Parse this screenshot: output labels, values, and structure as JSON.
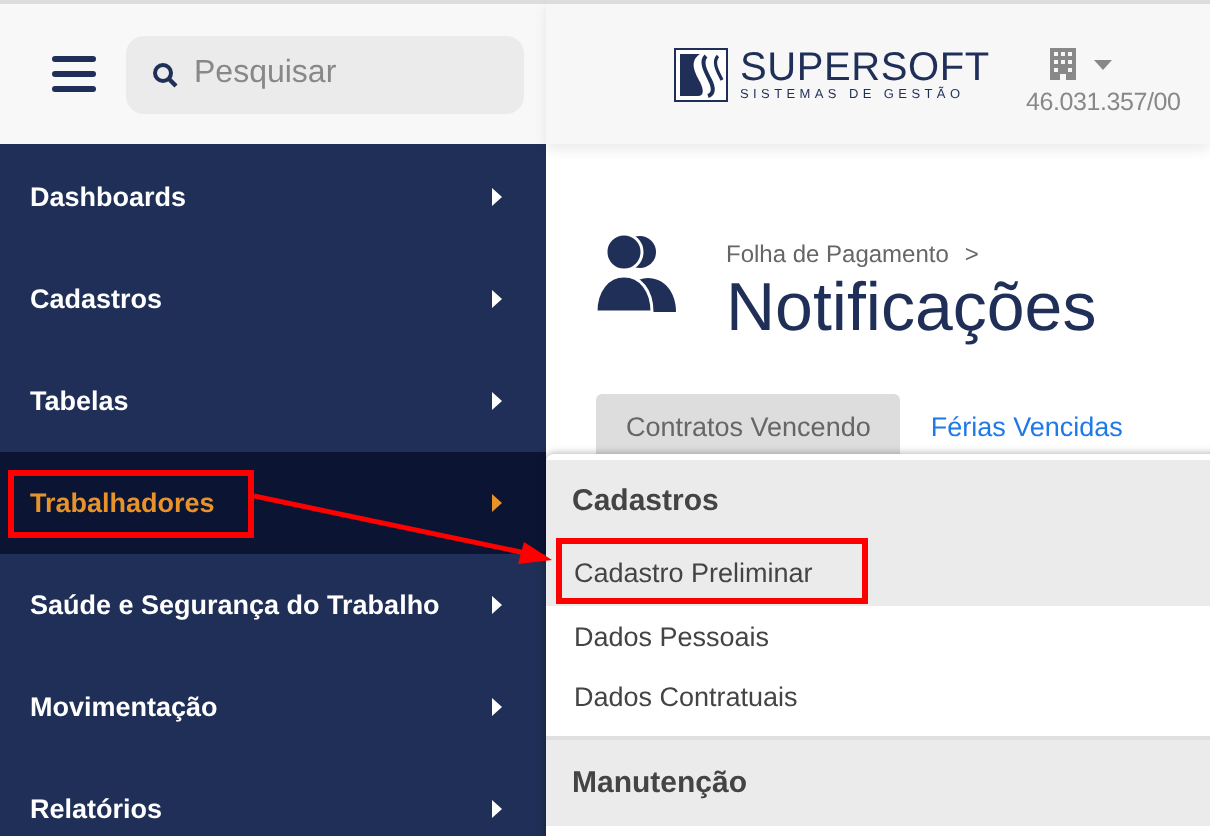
{
  "header": {
    "search": {
      "placeholder": "Pesquisar"
    },
    "logo": {
      "name": "SUPERSOFT",
      "tagline": "SISTEMAS DE GESTÃO"
    },
    "company": {
      "document": "46.031.357/00"
    }
  },
  "sidebar": {
    "items": [
      {
        "label": "Dashboards",
        "selected": false,
        "annotated": false
      },
      {
        "label": "Cadastros",
        "selected": false,
        "annotated": false
      },
      {
        "label": "Tabelas",
        "selected": false,
        "annotated": false
      },
      {
        "label": "Trabalhadores",
        "selected": true,
        "annotated": true
      },
      {
        "label": "Saúde e Segurança do Trabalho",
        "selected": false,
        "annotated": false
      },
      {
        "label": "Movimentação",
        "selected": false,
        "annotated": false
      },
      {
        "label": "Relatórios",
        "selected": false,
        "annotated": false
      }
    ]
  },
  "page": {
    "breadcrumb": "Folha de Pagamento",
    "breadcrumb_separator": ">",
    "title": "Notificações",
    "tabs": [
      {
        "label": "Contratos Vencendo",
        "selected": true
      },
      {
        "label": "Férias Vencidas",
        "selected": false
      }
    ]
  },
  "submenu": {
    "sections": [
      {
        "title": "Cadastros",
        "items": [
          {
            "label": "Cadastro Preliminar",
            "hovered": true,
            "annotated": true
          },
          {
            "label": "Dados Pessoais",
            "hovered": false,
            "annotated": false
          },
          {
            "label": "Dados Contratuais",
            "hovered": false,
            "annotated": false
          }
        ]
      },
      {
        "title": "Manutenção"
      }
    ]
  }
}
